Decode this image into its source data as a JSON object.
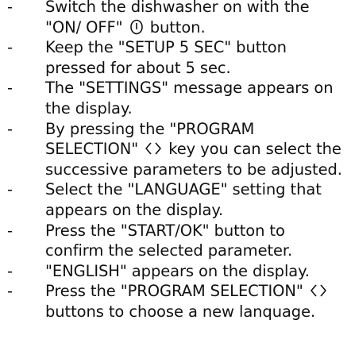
{
  "bullet": "-",
  "steps": [
    {
      "before": "Switch the dishwasher on with the \"ON/ OFF\" ",
      "icon": "power-icon",
      "after": " button."
    },
    {
      "text": "Keep the \"SETUP 5 SEC\" button pressed for about 5 sec."
    },
    {
      "text": "The \"SETTINGS\" message appears on the display."
    },
    {
      "before": "By pressing the \"PROGRAM SELECTION\" ",
      "icon": "left-right-arrows-icon",
      "after": " key you can select the successive parameters to be adjusted."
    },
    {
      "text": "Select the \"LANGUAGE\" setting that appears on the display."
    },
    {
      "text": "Press the \"START/OK\" button to confirm the selected parameter."
    },
    {
      "text": "\"ENGLISH\" appears on the display."
    },
    {
      "before": "Press the \"PROGRAM SELECTION\" ",
      "icon": "left-right-arrows-icon",
      "after": " buttons to choose a new lanquage."
    }
  ]
}
